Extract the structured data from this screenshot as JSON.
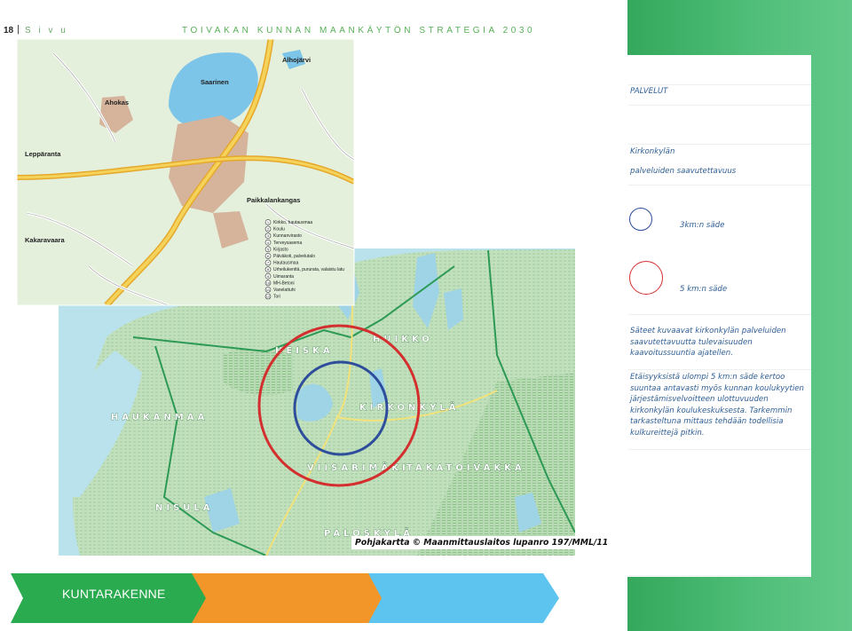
{
  "header": {
    "page_number": "18",
    "page_word": "S i v u",
    "doc_title": "TOIVAKAN KUNNAN MAANKÄYTÖN STRATEGIA 2030"
  },
  "colors": {
    "green_band": "#3cae63",
    "panel_text": "#2e5e95",
    "circle_3km": "#2e4e9c",
    "circle_5km": "#d42f2f",
    "arrow_green": "#2aab4f",
    "arrow_orange": "#f2962a",
    "arrow_blue": "#5dc3ef"
  },
  "panel": {
    "section_title": "PALVELUT",
    "subtitle_line1": "Kirkonkylän",
    "subtitle_line2": "palveluiden saavutettavuus",
    "legend_3km": "3km:n säde",
    "legend_5km": "5 km:n säde",
    "para1": [
      "Säteet kuvaavat kirkonkylän palveluiden",
      "saavutettavuutta tulevaisuuden",
      "kaavoitussuuntia ajatellen."
    ],
    "para2": [
      "Etäisyyksistä ulompi 5 km:n säde kertoo",
      "suuntaa antavasti myös kunnan koulukyytien",
      "järjestämisvelvoitteen ulottuvuuden",
      "kirkonkylän koulukeskuksesta. Tarkemmin",
      "tarkasteltuna mittaus tehdään todellisia",
      "kulkureittejä pitkin."
    ]
  },
  "inset_map": {
    "place_names": [
      "Alhojärvi",
      "Saarinen",
      "Ahokas",
      "Leppäranta",
      "Kakaravaara",
      "Paikkalankangas"
    ],
    "legend": [
      {
        "n": "1",
        "label": "Kirkko, hautausmaa"
      },
      {
        "n": "2",
        "label": "Koulu"
      },
      {
        "n": "3",
        "label": "Kunnanvirasto"
      },
      {
        "n": "4",
        "label": "Terveysasema"
      },
      {
        "n": "5",
        "label": "Kirjasto"
      },
      {
        "n": "6",
        "label": "Päiväkoti, palvelutalo"
      },
      {
        "n": "7",
        "label": "Hautausmaa"
      },
      {
        "n": "8",
        "label": "Urheilukenttä, pururata, valaistu latu"
      },
      {
        "n": "9",
        "label": "Uimaranta"
      },
      {
        "n": "10",
        "label": "MH-Betoni"
      },
      {
        "n": "11",
        "label": "Vanelattuhi"
      },
      {
        "n": "12",
        "label": "Tori"
      }
    ]
  },
  "main_map": {
    "villages": [
      "HUIKKO",
      "HEISKA",
      "HAUKANMAA",
      "KIRKONKYLÄ",
      "VIISARIMÄKI",
      "TAKATOIVAKKA",
      "NISULA",
      "PALOSKYLÄ"
    ],
    "caption": "Pohjakartta © Maanmittauslaitos lupanro 197/MML/11"
  },
  "footer": {
    "arrow1_label": "KUNTARAKENNE"
  }
}
